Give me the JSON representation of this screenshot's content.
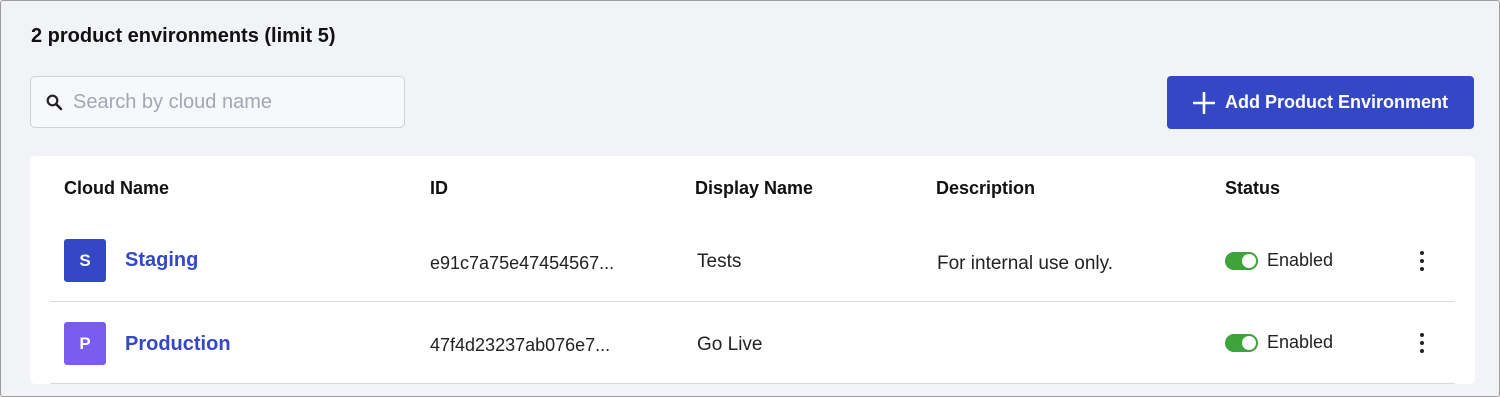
{
  "heading": "2 product environments (limit 5)",
  "search": {
    "placeholder": "Search by cloud name",
    "value": ""
  },
  "add_button": {
    "label": "Add Product Environment"
  },
  "table": {
    "columns": [
      "Cloud Name",
      "ID",
      "Display Name",
      "Description",
      "Status"
    ],
    "rows": [
      {
        "avatar_letter": "S",
        "avatar_color": "#3448c5",
        "cloud_name": "Staging",
        "id": "e91c7a75e47454567...",
        "display_name": "Tests",
        "description": "For internal use only.",
        "status": "Enabled",
        "enabled": true
      },
      {
        "avatar_letter": "P",
        "avatar_color": "#7b5cf0",
        "cloud_name": "Production",
        "id": "47f4d23237ab076e7...",
        "display_name": "Go Live",
        "description": "",
        "status": "Enabled",
        "enabled": true
      }
    ]
  },
  "colors": {
    "accent": "#3448c5",
    "toggle_on": "#3ea33a",
    "background": "#f2f3f7"
  },
  "icons": {
    "search": "search-icon",
    "add": "plus-icon",
    "row_menu": "kebab-menu-icon"
  }
}
